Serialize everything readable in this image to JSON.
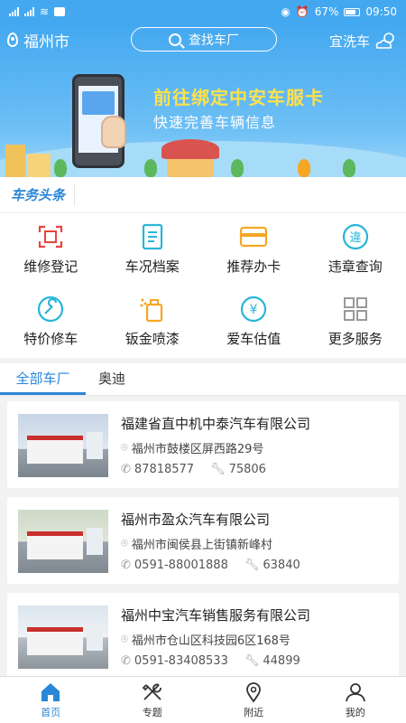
{
  "status": {
    "signal_left": "46",
    "signal_right": "36",
    "battery": "67%",
    "time": "09:50"
  },
  "header": {
    "city": "福州市",
    "search_label": "查找车厂",
    "wash_label": "宜洗车"
  },
  "banner": {
    "line1": "前往绑定中安车服卡",
    "line2": "快速完善车辆信息"
  },
  "news": {
    "title": "车务头条"
  },
  "services": [
    {
      "label": "维修登记",
      "icon": "scan-register-icon"
    },
    {
      "label": "车况档案",
      "icon": "document-icon"
    },
    {
      "label": "推荐办卡",
      "icon": "card-icon"
    },
    {
      "label": "违章查询",
      "icon": "violation-icon"
    },
    {
      "label": "特价修车",
      "icon": "wrench-circle-icon"
    },
    {
      "label": "钣金喷漆",
      "icon": "spray-paint-icon"
    },
    {
      "label": "爱车估值",
      "icon": "yuan-icon"
    },
    {
      "label": "更多服务",
      "icon": "more-grid-icon"
    }
  ],
  "tabs": [
    {
      "label": "全部车厂"
    },
    {
      "label": "奥迪"
    }
  ],
  "garages": [
    {
      "name": "福建省直中机中泰汽车有限公司",
      "address": "福州市鼓楼区屏西路29号",
      "phone": "87818577",
      "repairs": "75806"
    },
    {
      "name": "福州市盈众汽车有限公司",
      "address": "福州市闽侯县上街镇新峰村",
      "phone": "0591-88001888",
      "repairs": "63840"
    },
    {
      "name": "福州中宝汽车销售服务有限公司",
      "address": "福州市仓山区科技园6区168号",
      "phone": "0591-83408533",
      "repairs": "44899"
    }
  ],
  "nav": [
    {
      "label": "首页",
      "icon": "home-icon"
    },
    {
      "label": "专题",
      "icon": "tools-icon"
    },
    {
      "label": "附近",
      "icon": "location-icon"
    },
    {
      "label": "我的",
      "icon": "user-icon"
    }
  ],
  "colors": {
    "primary": "#43a8f0",
    "accent_blue": "#2a86d8",
    "banner_yellow": "#ffe14d",
    "icon_red": "#e8453c",
    "icon_orange": "#f5a623",
    "icon_cyan": "#29b6d8"
  }
}
